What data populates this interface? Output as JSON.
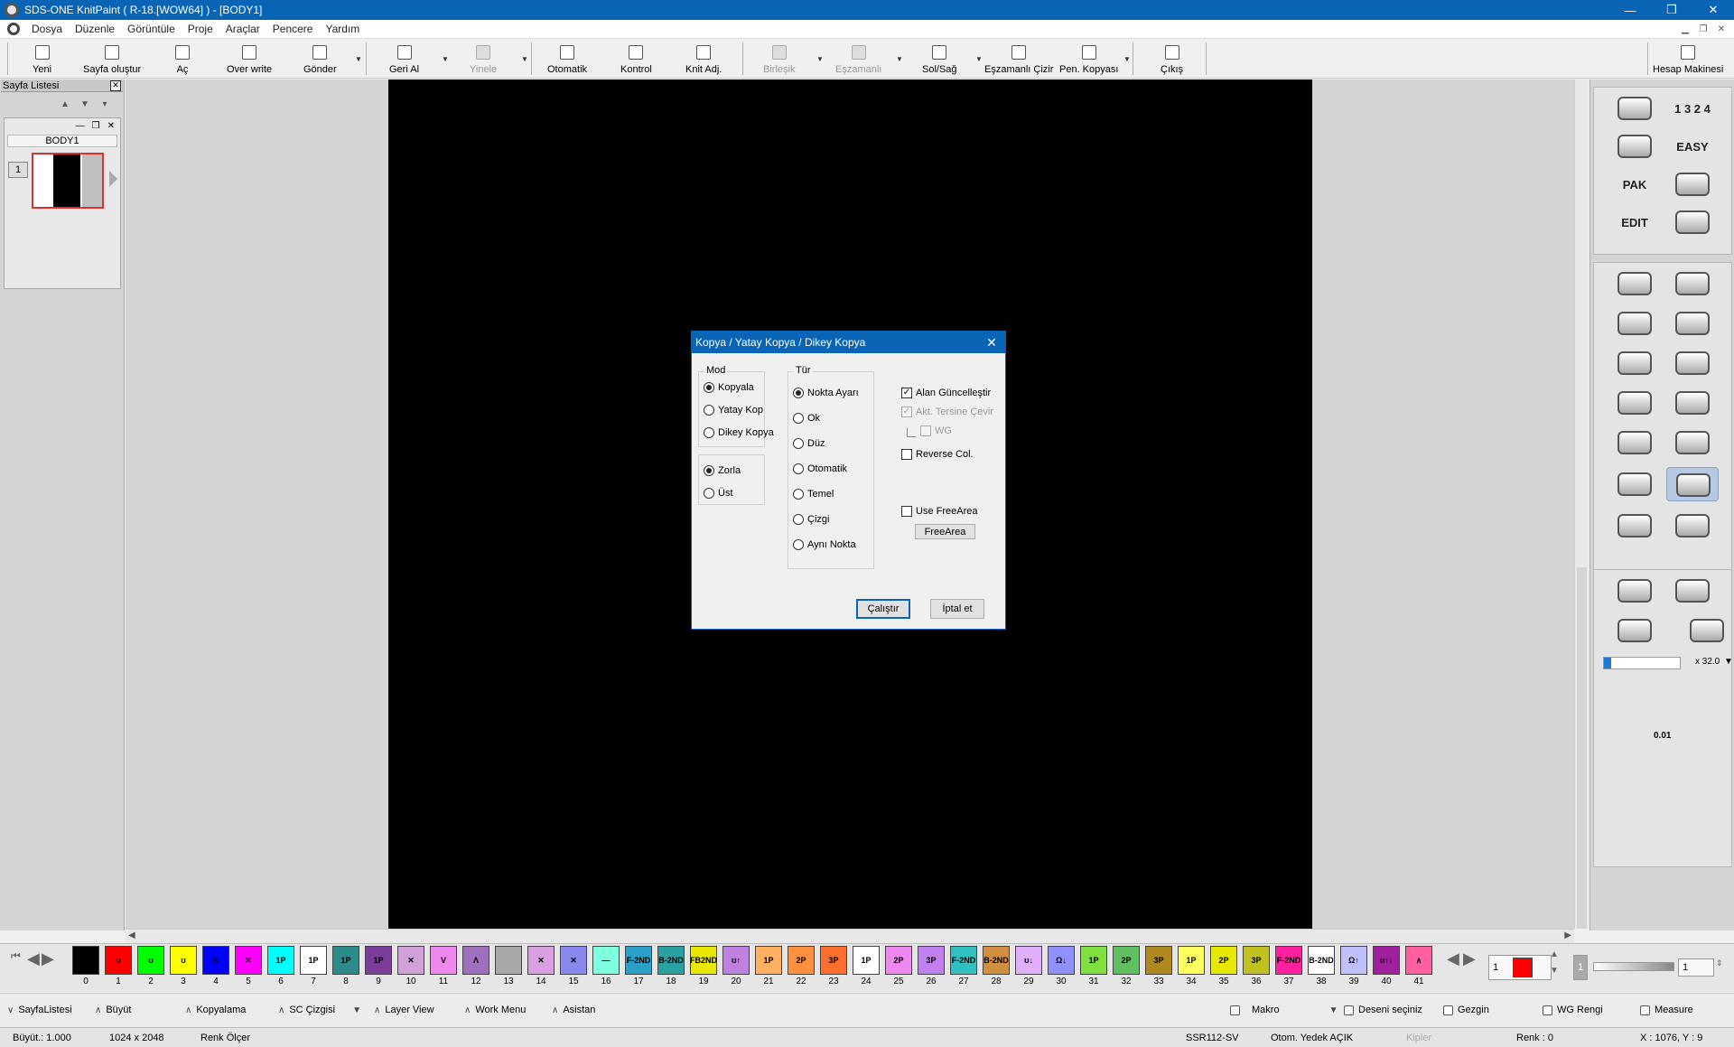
{
  "titlebar": {
    "title": "SDS-ONE KnitPaint ( R-18.[WOW64] ) - [BODY1]",
    "min": "—",
    "restore": "❐",
    "close": "✕"
  },
  "menu": [
    "Dosya",
    "Düzenle",
    "Görüntüle",
    "Proje",
    "Araçlar",
    "Pencere",
    "Yardım"
  ],
  "toolbar": {
    "yeni": "Yeni",
    "sayfa_olustur": "Sayfa oluştur",
    "ac": "Aç",
    "over_write": "Over write",
    "gonder": "Gönder",
    "geri_al": "Geri Al",
    "yinele": "Yinele",
    "otomatik": "Otomatik",
    "kontrol": "Kontrol",
    "knit_adj": "Knit Adj.",
    "birlesik": "Birleşik",
    "eszamanli": "Eşzamanlı",
    "sol_sag": "Sol/Sağ",
    "eszamanli_cizir": "Eşzamanlı Çizir",
    "pen_kopyasi": "Pen. Kopyası",
    "cikis": "Çıkış",
    "hesap_makinesi": "Hesap Makinesi"
  },
  "page_list": {
    "title": "Sayfa Listesi",
    "page_name": "BODY1",
    "page_number": "1"
  },
  "right_panel": {
    "easy": "EASY",
    "pak": "PAK",
    "edit": "EDIT",
    "zoom": "x 32.0",
    "step": "0.01",
    "numbers": "1 3 2 4"
  },
  "dialog": {
    "title": "Kopya / Yatay Kopya / Dikey Kopya",
    "mod_label": "Mod",
    "mod_options": [
      "Kopyala",
      "Yatay Kop",
      "Dikey Kopya"
    ],
    "mod_selected": 0,
    "overlay_options": [
      "Zorla",
      "Üst"
    ],
    "overlay_selected": 0,
    "tur_label": "Tür",
    "tur_options": [
      "Nokta Ayarı",
      "Ok",
      "Düz",
      "Otomatik",
      "Temel",
      "Çizgi",
      "Aynı Nokta"
    ],
    "tur_selected": 0,
    "alan_guncellestir": "Alan Güncelleştir",
    "akt_tersine_cevir": "Akt. Tersine Çevir",
    "wg": "WG",
    "reverse_col": "Reverse Col.",
    "use_freearea": "Use FreeArea",
    "freearea_button": "FreeArea",
    "run_button": "Çalıştır",
    "cancel_button": "İptal et"
  },
  "palette": {
    "chips": [
      {
        "n": "0",
        "c": "#000000",
        "t": ""
      },
      {
        "n": "1",
        "c": "#ff0000",
        "t": "ʊ"
      },
      {
        "n": "2",
        "c": "#00ff00",
        "t": "ʊ"
      },
      {
        "n": "3",
        "c": "#ffff00",
        "t": "ʊ"
      },
      {
        "n": "4",
        "c": "#0000ff",
        "t": "✕"
      },
      {
        "n": "5",
        "c": "#ff00ff",
        "t": "✕"
      },
      {
        "n": "6",
        "c": "#00ffff",
        "t": "1P"
      },
      {
        "n": "7",
        "c": "#ffffff",
        "t": "1P"
      },
      {
        "n": "8",
        "c": "#2e8b8b",
        "t": "1P"
      },
      {
        "n": "9",
        "c": "#7a3d9a",
        "t": "1P"
      },
      {
        "n": "10",
        "c": "#d0a0d8",
        "t": "✕"
      },
      {
        "n": "11",
        "c": "#ee88ee",
        "t": "V"
      },
      {
        "n": "12",
        "c": "#a070c0",
        "t": "Λ"
      },
      {
        "n": "13",
        "c": "#a8a8a8",
        "t": ""
      },
      {
        "n": "14",
        "c": "#d8a0e0",
        "t": "✕"
      },
      {
        "n": "15",
        "c": "#8888ee",
        "t": "✕"
      },
      {
        "n": "16",
        "c": "#80ffe0",
        "t": "—"
      },
      {
        "n": "17",
        "c": "#2aa0c8",
        "t": "F-2ND"
      },
      {
        "n": "18",
        "c": "#2aa0a0",
        "t": "B-2ND"
      },
      {
        "n": "19",
        "c": "#e8e800",
        "t": "FB2ND"
      },
      {
        "n": "20",
        "c": "#c080e0",
        "t": "ʊ↑"
      },
      {
        "n": "21",
        "c": "#ffb060",
        "t": "1P"
      },
      {
        "n": "22",
        "c": "#ff9040",
        "t": "2P"
      },
      {
        "n": "23",
        "c": "#ff7030",
        "t": "3P"
      },
      {
        "n": "24",
        "c": "#ffffff",
        "t": "1P"
      },
      {
        "n": "25",
        "c": "#ee88ee",
        "t": "2P"
      },
      {
        "n": "26",
        "c": "#c080f0",
        "t": "3P"
      },
      {
        "n": "27",
        "c": "#30c0c0",
        "t": "F-2ND"
      },
      {
        "n": "28",
        "c": "#d09040",
        "t": "B-2ND"
      },
      {
        "n": "29",
        "c": "#e0b0ff",
        "t": "ʊ↓"
      },
      {
        "n": "30",
        "c": "#9090ff",
        "t": "Ω↓"
      },
      {
        "n": "31",
        "c": "#80e040",
        "t": "1P"
      },
      {
        "n": "32",
        "c": "#60c060",
        "t": "2P"
      },
      {
        "n": "33",
        "c": "#b08820",
        "t": "3P"
      },
      {
        "n": "34",
        "c": "#ffff60",
        "t": "1P"
      },
      {
        "n": "35",
        "c": "#e8e800",
        "t": "2P"
      },
      {
        "n": "36",
        "c": "#c0c020",
        "t": "3P"
      },
      {
        "n": "37",
        "c": "#ff20a0",
        "t": "F-2ND"
      },
      {
        "n": "38",
        "c": "#ffffff",
        "t": "B-2ND"
      },
      {
        "n": "39",
        "c": "#c0c0ff",
        "t": "Ω↑"
      },
      {
        "n": "40",
        "c": "#a020a0",
        "t": "ʊ↑↓"
      },
      {
        "n": "41",
        "c": "#ff60a0",
        "t": "∧"
      }
    ],
    "color_index": "1",
    "current_color": "#ff0000",
    "value_box": "1",
    "value_box2": "1"
  },
  "bottombar": {
    "sayfa_listesi": "SayfaListesi",
    "buyut": "Büyüt",
    "kopyalama": "Kopyalama",
    "sc_cizgisi": "SC Çizgisi",
    "layer_view": "Layer View",
    "work_menu": "Work Menu",
    "asistan": "Asistan",
    "makro": "Makro",
    "deseni_seciniz": "Deseni seçiniz",
    "gezgin": "Gezgin",
    "wg_rengi": "WG Rengi",
    "measure": "Measure"
  },
  "status": {
    "buyut": "Büyüt.: 1.000",
    "size": "1024 x 2048",
    "renk_olcer": "Renk Ölçer",
    "ssr": "SSR112-SV",
    "otom": "Otom. Yedek AÇIK",
    "kilitler": "Kipler",
    "renk": "Renk :  0",
    "coords": "X : 1076, Y :   9"
  }
}
